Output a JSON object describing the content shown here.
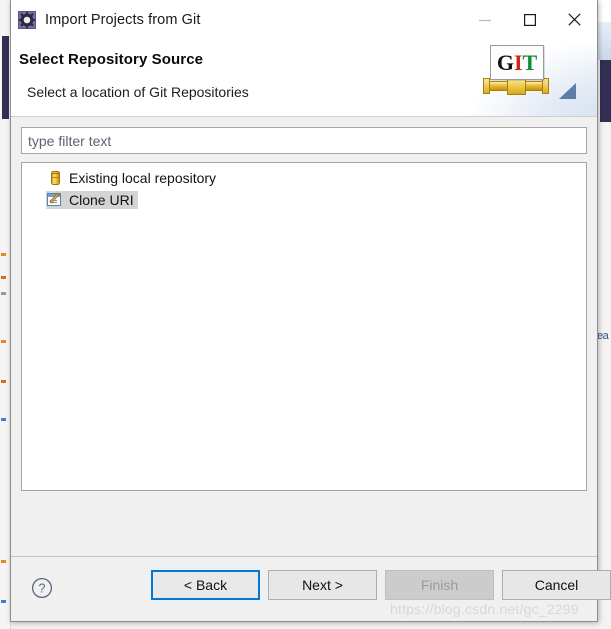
{
  "window": {
    "title": "Import Projects from Git",
    "icon": "eclipse-gear-icon",
    "controls": {
      "minimize": "minimize-icon",
      "maximize": "maximize-icon",
      "close": "close-icon"
    }
  },
  "header": {
    "title": "Select Repository Source",
    "subtitle": "Select a location of Git Repositories",
    "logo": {
      "letters": [
        "G",
        "I",
        "T"
      ],
      "letter_colors": [
        "#111111",
        "#d2231f",
        "#0f8a35"
      ],
      "pipe_color": "#e8b82c"
    }
  },
  "filter": {
    "value": "",
    "placeholder": "type filter text"
  },
  "tree": {
    "items": [
      {
        "label": "Existing local repository",
        "icon": "repository-cylinder-icon",
        "selected": false
      },
      {
        "label": "Clone URI",
        "icon": "clone-uri-form-pencil-icon",
        "selected": true
      }
    ]
  },
  "footer": {
    "help_icon": "help-question-icon",
    "buttons": [
      {
        "label": "< Back",
        "name": "back-button",
        "state": "focused"
      },
      {
        "label": "Next >",
        "name": "next-button",
        "state": "enabled"
      },
      {
        "label": "Finish",
        "name": "finish-button",
        "state": "disabled"
      },
      {
        "label": "Cancel",
        "name": "cancel-button",
        "state": "enabled"
      }
    ]
  },
  "watermark": {
    "text": "https://blog.csdn.net/gc_2299"
  },
  "backdrop": {
    "right_label": "ea",
    "accent_dark": "#332e54"
  },
  "colors": {
    "focus_blue": "#0078d7",
    "selection_gray": "#d4d4d4",
    "dialog_bg": "#f0f0f0"
  }
}
